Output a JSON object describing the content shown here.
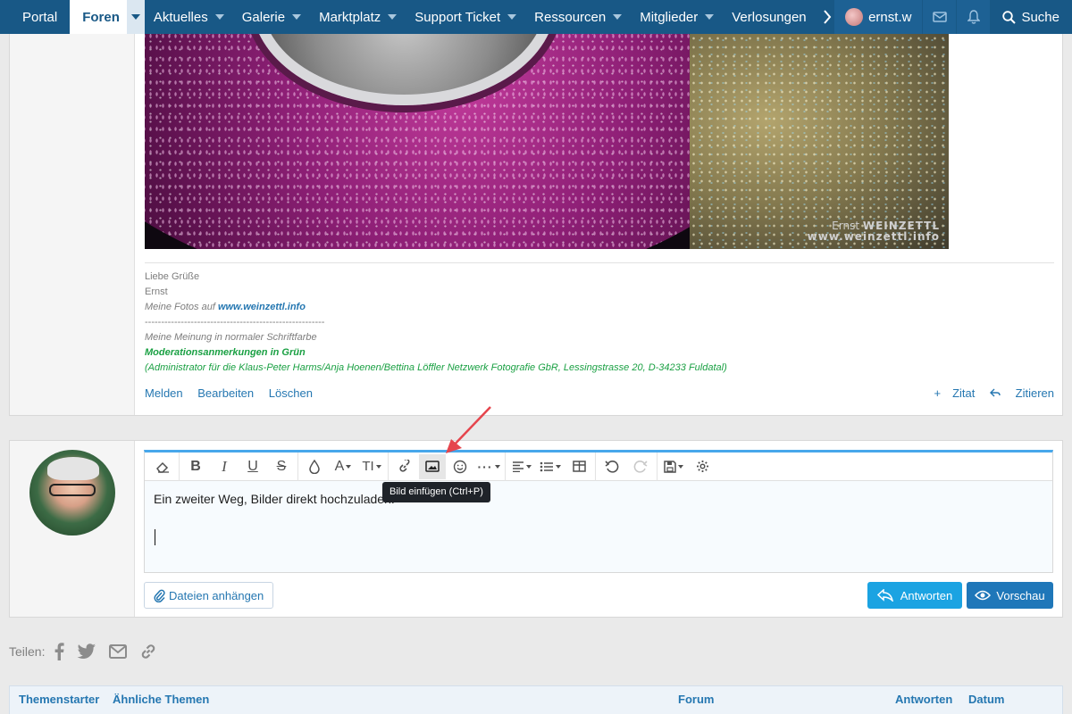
{
  "nav": {
    "items": [
      {
        "label": "Portal"
      },
      {
        "label": "Foren"
      },
      {
        "label": "Aktuelles"
      },
      {
        "label": "Galerie"
      },
      {
        "label": "Marktplatz"
      },
      {
        "label": "Support Ticket"
      },
      {
        "label": "Ressourcen"
      },
      {
        "label": "Mitglieder"
      },
      {
        "label": "Verlosungen"
      }
    ],
    "user": "ernst.w",
    "search": "Suche"
  },
  "post": {
    "photo_watermark_line1": "Ernst",
    "photo_watermark_line1b": "WEINZETTL",
    "photo_watermark_line2": "www.weinzettl.info",
    "signature": {
      "greeting": "Liebe Grüße",
      "name": "Ernst",
      "fotos_prefix": "Meine Fotos auf ",
      "fotos_link": "www.weinzettl.info",
      "divider": "-------------------------------------------------------",
      "opinion": "Meine Meinung in normaler Schriftfarbe",
      "moderation": "Moderationsanmerkungen in Grün",
      "admin": "(Administrator für die Klaus-Peter Harms/Anja Hoenen/Bettina Löffler Netzwerk Fotografie GbR, Lessingstrasse 20, D-34233 Fuldatal)"
    },
    "actions": {
      "report": "Melden",
      "edit": "Bearbeiten",
      "delete": "Löschen",
      "quote_plus": "Zitat",
      "quote": "Zitieren"
    }
  },
  "reply": {
    "text": "Ein zweiter Weg, Bilder direkt hochzuladen.",
    "tooltip": "Bild einfügen (Ctrl+P)",
    "attach": "Dateien anhängen",
    "answer": "Antworten",
    "preview": "Vorschau"
  },
  "share": {
    "label": "Teilen:"
  },
  "similar": {
    "columns": [
      "Themenstarter",
      "Ähnliche Themen",
      "Forum",
      "Antworten",
      "Datum"
    ]
  },
  "colors": {
    "nav_bg": "#185886",
    "link": "#2577b1",
    "green": "#1aa043",
    "accent": "#47a7eb",
    "annotation_arrow": "#e5454d"
  }
}
